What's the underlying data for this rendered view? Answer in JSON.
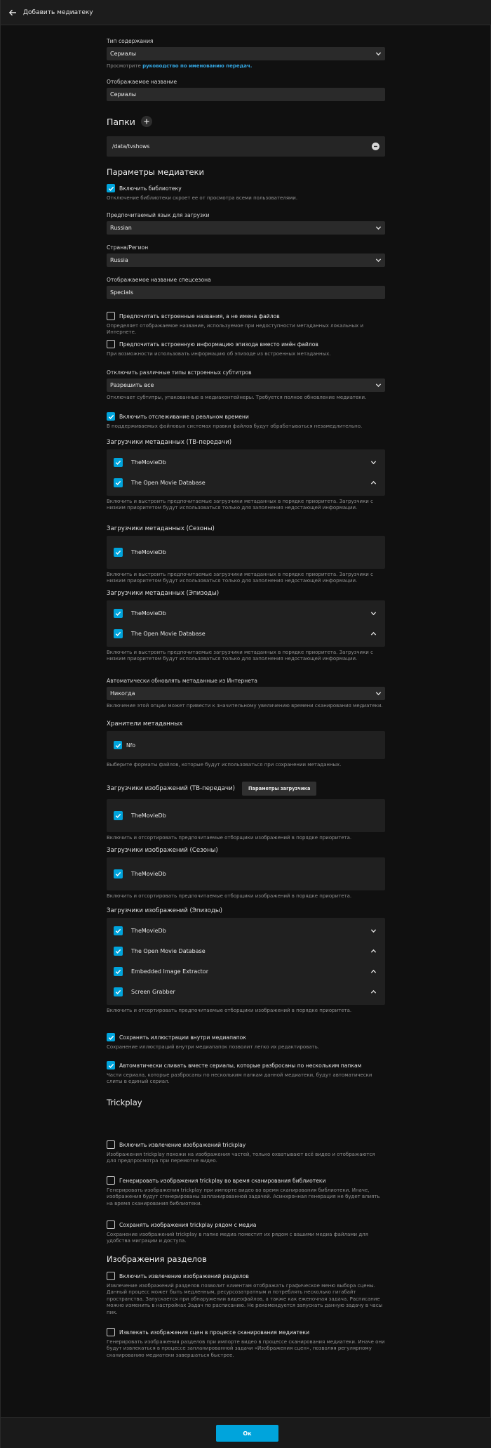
{
  "header": {
    "title": "Добавить медиатеку"
  },
  "content_type": {
    "label": "Тип содержания",
    "value": "Сериалы",
    "help_prefix": "Просмотрите ",
    "help_link": "руководство по именованию передач."
  },
  "display_name": {
    "label": "Отображаемое название",
    "value": "Сериалы"
  },
  "folders": {
    "title": "Папки",
    "path": "/data/tvshows"
  },
  "library_settings": {
    "title": "Параметры медиатеки"
  },
  "enable_library": {
    "label": "Включить библиотеку",
    "help": "Отключение библиотеки скроет ее от просмотра всеми пользователями."
  },
  "language": {
    "label": "Предпочитаемый язык для загрузки",
    "value": "Russian"
  },
  "country": {
    "label": "Страна/Регион",
    "value": "Russia"
  },
  "specials": {
    "label": "Отображаемое название спецсезона",
    "value": "Specials"
  },
  "prefer_embedded_titles": {
    "label": "Предпочитать встроенные названия, а не имена файлов",
    "help": "Определяет отображаемое название, используемое при недоступности метаданных локальных и Интернете."
  },
  "prefer_embedded_episode": {
    "label": "Предпочитать встроенную информацию эпизода вместо имён файлов",
    "help": "При возможности использовать информацию об эпизоде из встроенных метаданных."
  },
  "subtitles": {
    "label": "Отключить различные типы встроенных субтитров",
    "value": "Разрешить все",
    "help": "Отключает субтитры, упакованные в медиаконтейнеры. Требуется полное обновление медиатеки."
  },
  "realtime": {
    "label": "Включить отслеживание в реальном времени",
    "help": "В поддерживаемых файловых системах правки файлов будут обрабатываться незамедлительно."
  },
  "meta_series": {
    "title": "Загрузчики метаданных (ТВ-передачи)",
    "items": [
      "TheMovieDb",
      "The Open Movie Database"
    ]
  },
  "meta_seasons": {
    "title": "Загрузчики метаданных (Сезоны)",
    "items": [
      "TheMovieDb"
    ]
  },
  "meta_episodes": {
    "title": "Загрузчики метаданных (Эпизоды)",
    "items": [
      "TheMovieDb",
      "The Open Movie Database"
    ]
  },
  "meta_help": "Включить и выстроить предпочитаемые загрузчики метаданных в порядке приоритета. Загрузчики с низким приоритетом будут использоваться только для заполнения недостающей информации.",
  "auto_refresh": {
    "label": "Автоматически обновлять метаданные из Интернета",
    "value": "Никогда",
    "help": "Включение этой опции может привести к значительному увеличению времени сканирования медиатеки."
  },
  "savers": {
    "title": "Хранители метаданных",
    "item": "Nfo",
    "help": "Выберите форматы файлов, которые будут использоваться при сохранении метаданных."
  },
  "img_series": {
    "title": "Загрузчики изображений (ТВ-передачи)",
    "button": "Параметры загрузчика",
    "items": [
      "TheMovieDb"
    ]
  },
  "img_seasons": {
    "title": "Загрузчики изображений (Сезоны)",
    "items": [
      "TheMovieDb"
    ]
  },
  "img_episodes": {
    "title": "Загрузчики изображений (Эпизоды)",
    "items": [
      "TheMovieDb",
      "The Open Movie Database",
      "Embedded Image Extractor",
      "Screen Grabber"
    ]
  },
  "img_help": "Включить и отсортировать предпочитаемые отборщики изображений в порядке приоритета.",
  "save_artwork": {
    "label": "Сохранять иллюстрации внутри медиапапок",
    "help": "Сохранение иллюстраций внутри медиапапок позволит легко их редактировать."
  },
  "merge_series": {
    "label": "Автоматически сливать вместе сериалы, которые разбросаны по нескольким папкам",
    "help": "Части сериала, которые разбросаны по нескольким папкам данной медиатеки, будут автоматически слиты в единый сериал."
  },
  "trickplay": {
    "title": "Trickplay",
    "extract": {
      "label": "Включить извлечение изображений trickplay",
      "help": "Изображения trickplay похожи на изображения частей, только охватывают всё видео и отображаются для предпросмотра при перемотке видео."
    },
    "during_scan": {
      "label": "Генерировать изображения trickplay во время сканирования библиотеки",
      "help": "Генерировать изображения trickplay при импорте видео во время сканирования библиотеки. Иначе, изображения будут сгенерированы запланированной задачей. Асинхронная генерация не будет влиять на время сканирования библиотеки."
    },
    "save_near": {
      "label": "Сохранять изображения trickplay рядом с медиа",
      "help": "Сохранение изображений trickplay в папке медиа поместит их рядом с вашими медиа файлами для удобства миграции и доступа."
    }
  },
  "chapters": {
    "title": "Изображения разделов",
    "extract": {
      "label": "Включить извлечение изображений разделов",
      "help": "Извлечение изображений разделов позволит клиентам отображать графическое меню выбора сцены. Данный процесс может быть медленным, ресурсозатратным и потреблять несколько гигабайт пространства. Запускается при обнаружении видеофайлов, а также как еженочная задача. Расписание можно изменить в настройках Задач по расписанию. Не рекомендуется запускать данную задачу в часы пик."
    },
    "during_scan": {
      "label": "Извлекать изображения сцен в процессе сканирования медиатеки",
      "help": "Генерировать изображения разделов при импорте видео в процессе сканирования медиатеки. Иначе они будут извлекаться в процессе запланированной задачи «Изображения сцен», позволяя регулярному сканированию медиатеки завершаться быстрее."
    }
  },
  "footer": {
    "ok": "Ок"
  }
}
